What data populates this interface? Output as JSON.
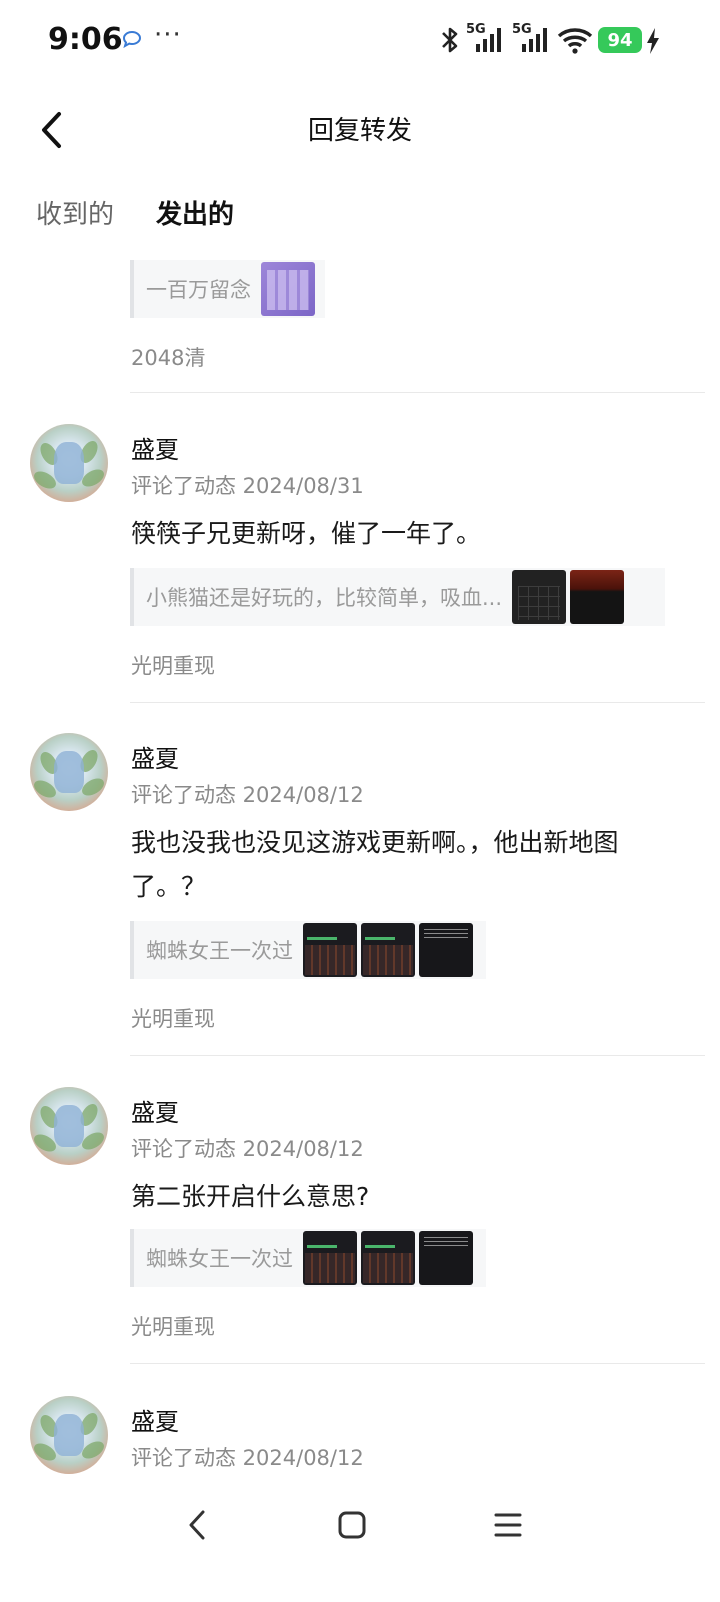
{
  "status_bar": {
    "time": "9:06",
    "dots": "···",
    "battery": "94",
    "net1": "5G",
    "net2": "5G"
  },
  "header": {
    "title": "回复转发"
  },
  "tabs": [
    {
      "label": "收到的"
    },
    {
      "label": "发出的",
      "active": true
    }
  ],
  "partial_item": {
    "quote_text": "一百万留念",
    "source": "2048清"
  },
  "items": [
    {
      "username": "盛夏",
      "meta": "评论了动态 2024/08/31",
      "comment": "筷筷子兄更新呀，催了一年了。",
      "quote_text": "小熊猫还是好玩的，比较简单，吸血...",
      "source": "光明重现"
    },
    {
      "username": "盛夏",
      "meta": "评论了动态 2024/08/12",
      "comment": "我也没我也没见这游戏更新啊。，他出新地图了。？",
      "quote_text": "蜘蛛女王一次过",
      "source": "光明重现"
    },
    {
      "username": "盛夏",
      "meta": "评论了动态 2024/08/12",
      "comment": "第二张开启什么意思?",
      "quote_text": "蜘蛛女王一次过",
      "source": "光明重现"
    },
    {
      "username": "盛夏",
      "meta": "评论了动态 2024/08/12"
    }
  ],
  "colors": {
    "accent": "#4fd1c1",
    "battery": "#35c95a"
  }
}
